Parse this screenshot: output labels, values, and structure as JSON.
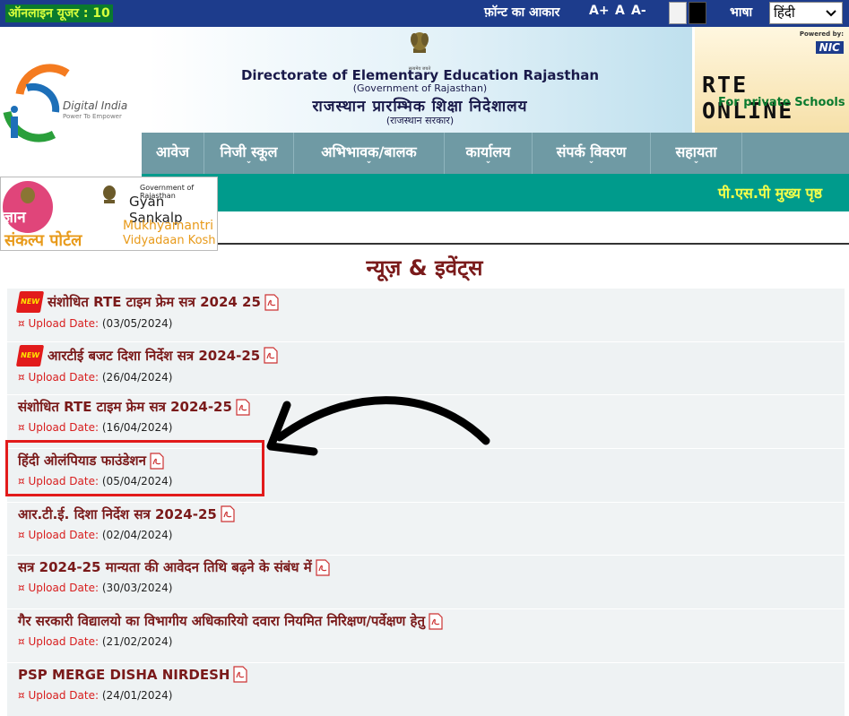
{
  "topbar": {
    "online_users": "ऑनलाइन यूजर : 10",
    "font_size_label": "फ़ॉन्ट का आकार",
    "font_increase": "A+",
    "font_normal": "A",
    "font_decrease": "A-",
    "language_label": "भाषा",
    "language_selected": "हिंदी"
  },
  "logos": {
    "digital_india": "Digital India",
    "digital_india_tagline": "Power To Empower",
    "emblem_caption": "सत्यमेव जयते"
  },
  "banner": {
    "title": "Directorate of Elementary Education Rajasthan",
    "subtitle": "(Government of Rajasthan)",
    "hindi_title": "राजस्थान प्रारम्भिक शिक्षा निदेशालय",
    "hindi_subtitle": "(राजस्थान सरकार)"
  },
  "rte": {
    "powered_by": "Powered by:",
    "nic": "NIC",
    "title": "RTE ONLINE",
    "subtitle": "For private Schools"
  },
  "nav": {
    "items": [
      {
        "label": "आवेज"
      },
      {
        "label": "निजी स्कूल"
      },
      {
        "label": "अभिभावक/बालक"
      },
      {
        "label": "कार्यालय"
      },
      {
        "label": "संपर्क विवरण"
      },
      {
        "label": "सहायता"
      }
    ],
    "caret": "⌄"
  },
  "psp_link": "पी.एस.पी मुख्य पृष्ठ",
  "gyan": {
    "gov": "Government of Rajasthan",
    "title": "Gyan Sankalp",
    "logo_hindi": "ज्ञान",
    "sankalp_hindi": "संकल्प पोर्टल",
    "mukhyamantri": "Mukhyamantri",
    "vidyadaan": "Vidyadaan Kosh"
  },
  "news": {
    "heading": "न्यूज़ & इवेंट्स",
    "upload_label": "¤ Upload Date:",
    "new_badge": "NEW",
    "items": [
      {
        "title": "संशोधित RTE टाइम फ्रेम सत्र 2024 25",
        "date": "(03/05/2024)",
        "is_new": true
      },
      {
        "title": "आरटीई बजट दिशा निर्देश सत्र 2024-25",
        "date": "(26/04/2024)",
        "is_new": true
      },
      {
        "title": "संशोधित RTE टाइम फ्रेम सत्र 2024-25",
        "date": "(16/04/2024)",
        "is_new": false
      },
      {
        "title": "हिंदी ओलंपियाड फाउंडेशन",
        "date": "(05/04/2024)",
        "is_new": false
      },
      {
        "title": "आर.टी.ई. दिशा निर्देश सत्र 2024-25",
        "date": "(02/04/2024)",
        "is_new": false
      },
      {
        "title": "सत्र 2024-25 मान्यता की आवेदन तिथि बढ़ने के संबंध में",
        "date": "(30/03/2024)",
        "is_new": false
      },
      {
        "title": "गैर सरकारी विद्यालयो का विभागीय अधिकारियो दवारा नियमित निरिक्षण/पर्वेक्षण हेतु",
        "date": "(21/02/2024)",
        "is_new": false
      },
      {
        "title": "PSP MERGE DISHA NIRDESH",
        "date": "(24/01/2024)",
        "is_new": false
      }
    ]
  },
  "colors": {
    "topbar": "#1d3c8c",
    "nav": "#6f9aa4",
    "teal": "#009b8c",
    "news_title": "#7a1a1a",
    "highlight": "#e21b1b"
  }
}
